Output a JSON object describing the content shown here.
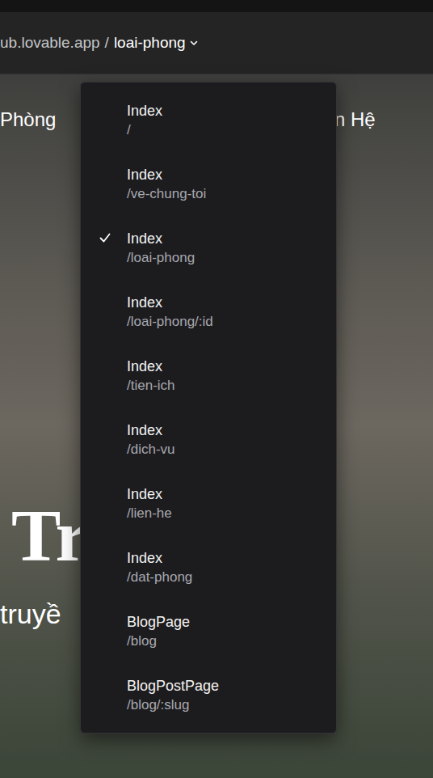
{
  "address_bar": {
    "host": "ub.lovable.app",
    "separator": "/",
    "route": "loai-phong"
  },
  "hero": {
    "nav": [
      "Phòng",
      "n Hệ"
    ],
    "title": "Tr",
    "subtitle": "truyề"
  },
  "route_menu": {
    "items": [
      {
        "name": "Index",
        "path": "/",
        "selected": false
      },
      {
        "name": "Index",
        "path": "/ve-chung-toi",
        "selected": false
      },
      {
        "name": "Index",
        "path": "/loai-phong",
        "selected": true
      },
      {
        "name": "Index",
        "path": "/loai-phong/:id",
        "selected": false
      },
      {
        "name": "Index",
        "path": "/tien-ich",
        "selected": false
      },
      {
        "name": "Index",
        "path": "/dich-vu",
        "selected": false
      },
      {
        "name": "Index",
        "path": "/lien-he",
        "selected": false
      },
      {
        "name": "Index",
        "path": "/dat-phong",
        "selected": false
      },
      {
        "name": "BlogPage",
        "path": "/blog",
        "selected": false
      },
      {
        "name": "BlogPostPage",
        "path": "/blog/:slug",
        "selected": false
      }
    ]
  }
}
